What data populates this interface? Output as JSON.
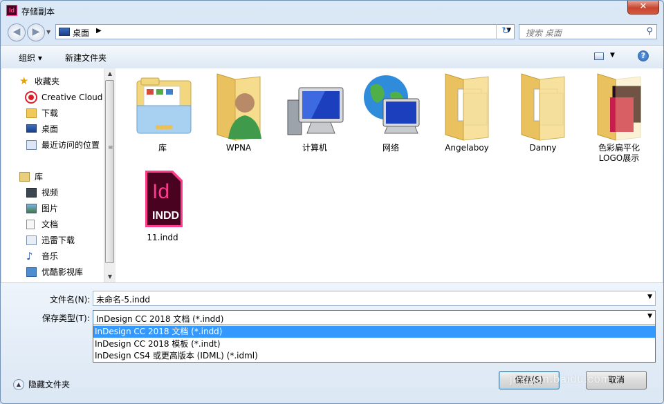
{
  "window": {
    "title": "存储副本",
    "app_icon": "Id",
    "close_symbol": "✕"
  },
  "nav": {
    "back_symbol": "◀",
    "forward_symbol": "▶",
    "history_symbol": "▼",
    "address": "桌面",
    "address_sep": "▶",
    "address_dd": "▼",
    "refresh_symbol": "↻",
    "search_placeholder": "搜索 桌面",
    "search_symbol": "⚲"
  },
  "toolbar": {
    "organize": "组织 ▾",
    "new_folder": "新建文件夹",
    "view_dd": "▼",
    "help": "?"
  },
  "sidebar": {
    "favorites": {
      "label": "收藏夹",
      "icon": "star-icon"
    },
    "favorite_items": [
      {
        "label": "Creative Cloud",
        "icon": "creative-cloud-icon"
      },
      {
        "label": "下载",
        "icon": "download-folder-icon"
      },
      {
        "label": "桌面",
        "icon": "desktop-icon"
      },
      {
        "label": "最近访问的位置",
        "icon": "recent-places-icon"
      }
    ],
    "libraries": {
      "label": "库",
      "icon": "library-icon"
    },
    "library_items": [
      {
        "label": "视频",
        "icon": "video-icon"
      },
      {
        "label": "图片",
        "icon": "pictures-icon"
      },
      {
        "label": "文档",
        "icon": "documents-icon"
      },
      {
        "label": "迅雷下载",
        "icon": "thunder-download-icon"
      },
      {
        "label": "音乐",
        "icon": "music-icon"
      },
      {
        "label": "优酷影视库",
        "icon": "youku-icon"
      }
    ],
    "scroll": {
      "up": "▲",
      "down": "▼",
      "grip": "≡"
    }
  },
  "files": [
    {
      "name": "库",
      "icon": "library-folder-icon"
    },
    {
      "name": "WPNA",
      "icon": "user-folder-icon"
    },
    {
      "name": "计算机",
      "icon": "computer-icon"
    },
    {
      "name": "网络",
      "icon": "network-icon"
    },
    {
      "name": "Angelaboy",
      "icon": "folder-icon"
    },
    {
      "name": "Danny",
      "icon": "folder-icon"
    },
    {
      "name": "色彩扁平化\nLOGO展示",
      "icon": "folder-icon"
    },
    {
      "name": "11.indd",
      "icon": "indesign-file-icon",
      "badge_top": "Id",
      "badge_bottom": "INDD"
    }
  ],
  "form": {
    "filename_label": "文件名(N):",
    "filename_value": "未命名-5.indd",
    "type_label": "保存类型(T):",
    "type_value": "InDesign CC 2018 文档 (*.indd)",
    "arrow": "▼",
    "type_options": [
      "InDesign CC 2018 文档 (*.indd)",
      "InDesign CC 2018 模板 (*.indt)",
      "InDesign CS4 或更高版本 (IDML) (*.idml)"
    ]
  },
  "footer": {
    "hide_folders": "隐藏文件夹",
    "hide_symbol": "▲",
    "save": "保存(S)",
    "cancel": "取消",
    "watermark": "jingyan.baidu.com"
  },
  "colors": {
    "indesign": "#49021f",
    "indesign_accent": "#ff3b8d",
    "selection": "#3399ff",
    "folder": "#f3d27a"
  }
}
